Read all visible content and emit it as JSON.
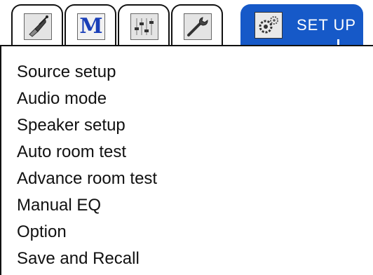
{
  "tabs": [
    {
      "icon": "satellite-dish-icon"
    },
    {
      "icon": "m-logo-icon",
      "letter": "M"
    },
    {
      "icon": "equalizer-icon"
    },
    {
      "icon": "wrench-icon"
    }
  ],
  "active_tab": {
    "icon": "gear-icon",
    "label": "SET UP"
  },
  "colors": {
    "active_tab": "#1659c8",
    "m_letter": "#1a3fb8"
  },
  "menu": {
    "items": [
      "Source setup",
      "Audio mode",
      "Speaker setup",
      "Auto room test",
      "Advance room test",
      "Manual EQ",
      "Option",
      "Save and Recall"
    ]
  }
}
